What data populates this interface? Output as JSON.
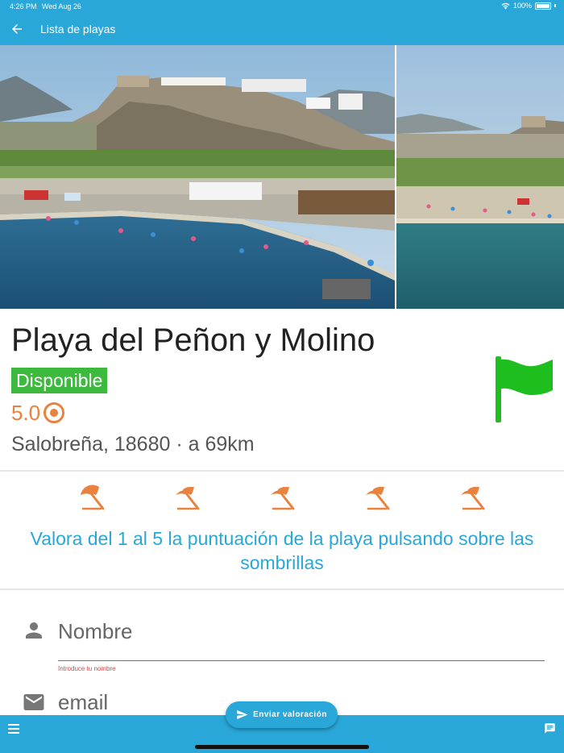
{
  "status_bar": {
    "time": "4:26 PM",
    "date": "Wed Aug 26",
    "battery": "100%",
    "icons": [
      "wifi-icon",
      "battery-icon"
    ]
  },
  "app_bar": {
    "title": "Lista de playas",
    "back_icon": "arrow-left-icon"
  },
  "beach": {
    "name": "Playa del Peñon y Molino",
    "status": "Disponible",
    "rating": "5.0",
    "location": "Salobreña, 18680 · a 69km",
    "flag_color": "#1fbe1f"
  },
  "rating_section": {
    "umbrella_count": 5,
    "umbrella_icon": "beach-umbrella-icon",
    "umbrella_color": "#e8823e",
    "help_text": "Valora del 1 al 5 la puntuación de la playa pulsando sobre las sombrillas"
  },
  "form": {
    "name_placeholder": "Nombre",
    "name_error": "Introduce tu nombre",
    "email_placeholder": "email"
  },
  "fab": {
    "label": "Enviar valoración",
    "icon": "send-icon"
  },
  "bottom_bar": {
    "left_icon": "menu-icon",
    "right_icon": "chat-icon"
  },
  "colors": {
    "primary": "#29a7d8",
    "available": "#3dba3d",
    "accent": "#e8823e",
    "error": "#d64848"
  }
}
